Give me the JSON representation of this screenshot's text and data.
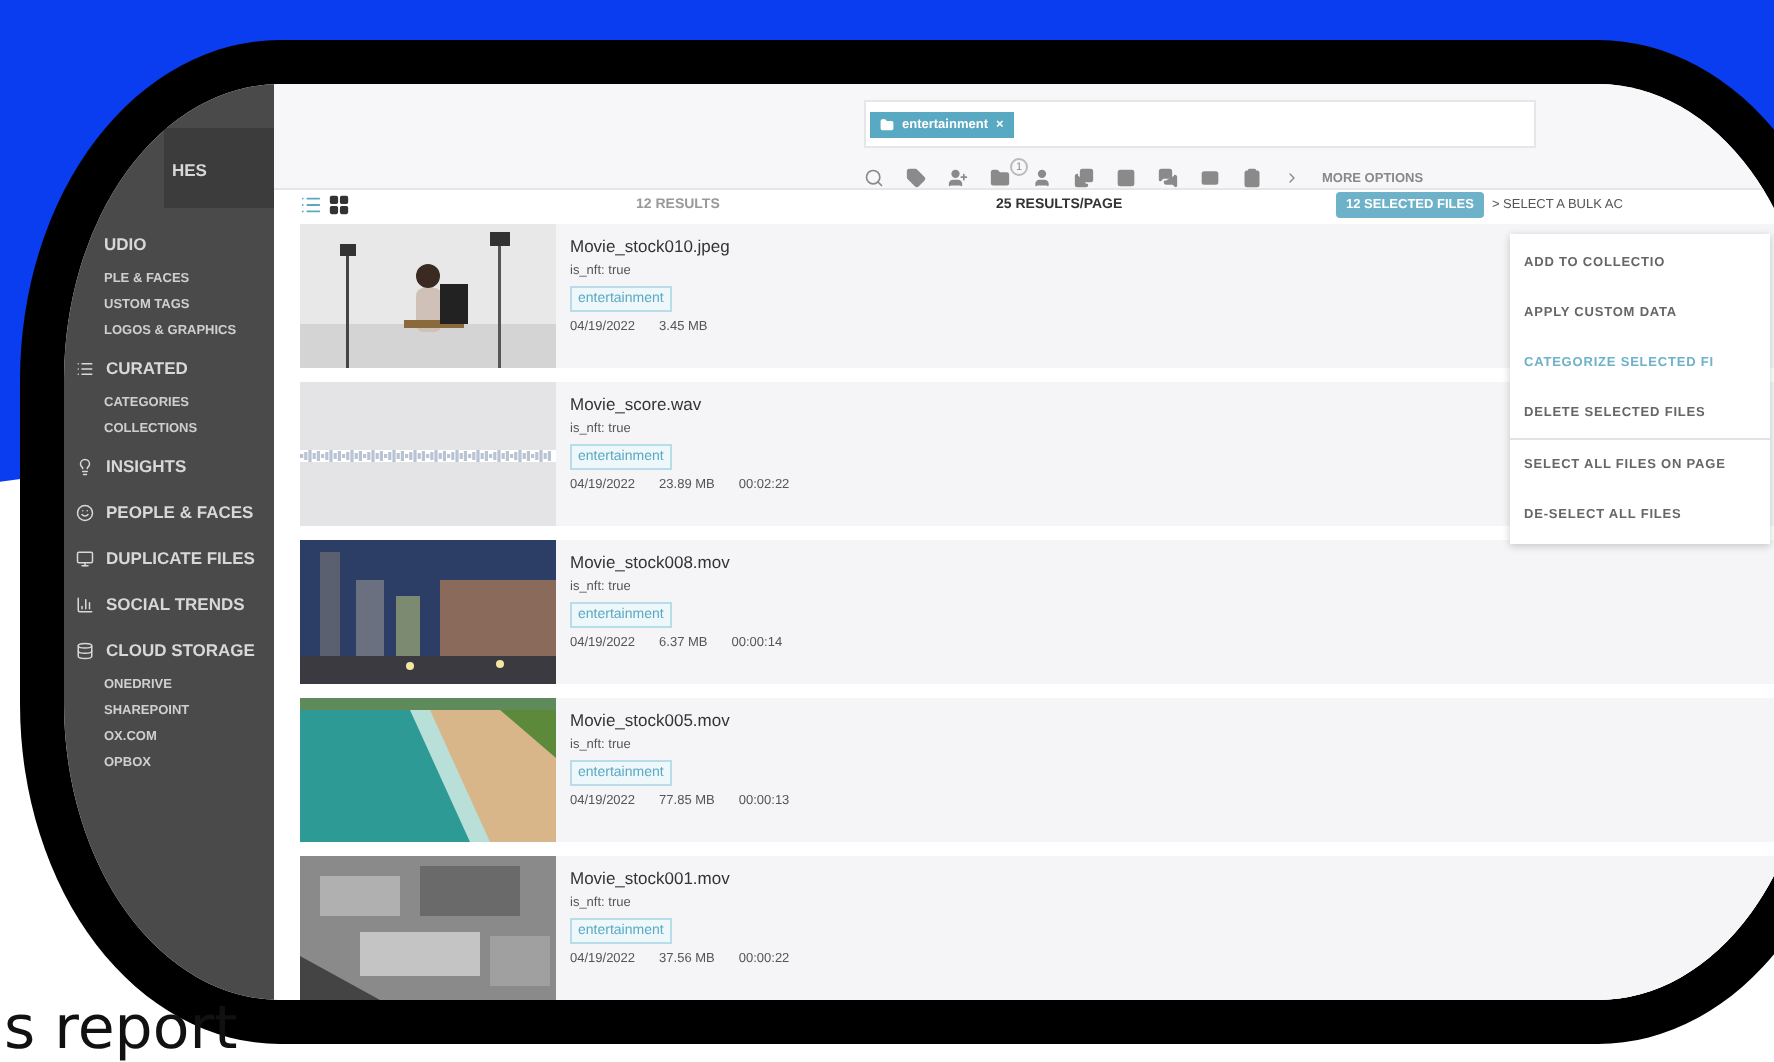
{
  "sidebar": {
    "items": [
      {
        "label": "HES",
        "kind": "header",
        "selected": true
      },
      {
        "label": "UDIO",
        "kind": "section"
      },
      {
        "label": "PLE & FACES",
        "kind": "sub"
      },
      {
        "label": "USTOM TAGS",
        "kind": "sub"
      },
      {
        "label": "LOGOS & GRAPHICS",
        "kind": "sub"
      },
      {
        "label": "CURATED",
        "kind": "section"
      },
      {
        "label": "CATEGORIES",
        "kind": "sub"
      },
      {
        "label": "COLLECTIONS",
        "kind": "sub"
      },
      {
        "label": "INSIGHTS",
        "kind": "section"
      },
      {
        "label": "PEOPLE & FACES",
        "kind": "section"
      },
      {
        "label": "DUPLICATE FILES",
        "kind": "section"
      },
      {
        "label": "SOCIAL TRENDS",
        "kind": "section"
      },
      {
        "label": "CLOUD STORAGE",
        "kind": "section"
      },
      {
        "label": "ONEDRIVE",
        "kind": "sub"
      },
      {
        "label": "SHAREPOINT",
        "kind": "sub"
      },
      {
        "label": "OX.COM",
        "kind": "sub"
      },
      {
        "label": "OPBOX",
        "kind": "sub"
      }
    ]
  },
  "filter_chip": {
    "label": "entertainment",
    "close": "×"
  },
  "toolbar": {
    "folder_badge": "1",
    "more": "MORE OPTIONS"
  },
  "results_bar": {
    "views": [
      {
        "kind": "list",
        "selected": true
      },
      {
        "kind": "grid",
        "selected": false
      }
    ],
    "count": "12 RESULTS",
    "per_page": "25 RESULTS/PAGE",
    "selected_button": "12 SELECTED FILES",
    "bulk_label": "> SELECT A BULK AC"
  },
  "bulk_menu": [
    {
      "label": "ADD TO COLLECTIO",
      "selected": false,
      "divider": false
    },
    {
      "label": "APPLY CUSTOM DATA",
      "selected": false,
      "divider": false
    },
    {
      "label": "CATEGORIZE SELECTED FI",
      "selected": true,
      "divider": false
    },
    {
      "label": "DELETE SELECTED FILES",
      "selected": false,
      "divider": true
    },
    {
      "label": "SELECT ALL FILES ON PAGE",
      "selected": false,
      "divider": false
    },
    {
      "label": "DE-SELECT ALL FILES",
      "selected": false,
      "divider": false
    }
  ],
  "files": [
    {
      "name": "Movie_stock010.jpeg",
      "meta": "is_nft: true",
      "tag": "entertainment",
      "date": "04/19/2022",
      "size": "3.45 MB"
    },
    {
      "kind": "audio",
      "name": "Movie_score.wav",
      "meta": "is_nft: true",
      "tag": "entertainment",
      "date": "04/19/2022",
      "size": "23.89 MB",
      "duration": "00:02:22"
    },
    {
      "kind": "video",
      "name": "Movie_stock008.mov",
      "meta": "is_nft: true",
      "tag": "entertainment",
      "date": "04/19/2022",
      "size": "6.37 MB",
      "duration": "00:00:14"
    },
    {
      "kind": "video",
      "name": "Movie_stock005.mov",
      "meta": "is_nft: true",
      "tag": "entertainment",
      "date": "04/19/2022",
      "size": "77.85 MB",
      "duration": "00:00:13"
    },
    {
      "kind": "video",
      "name": "Movie_stock001.mov",
      "meta": "is_nft: true",
      "tag": "entertainment",
      "date": "04/19/2022",
      "size": "37.56 MB",
      "duration": "00:00:22"
    }
  ],
  "caption": "s report"
}
